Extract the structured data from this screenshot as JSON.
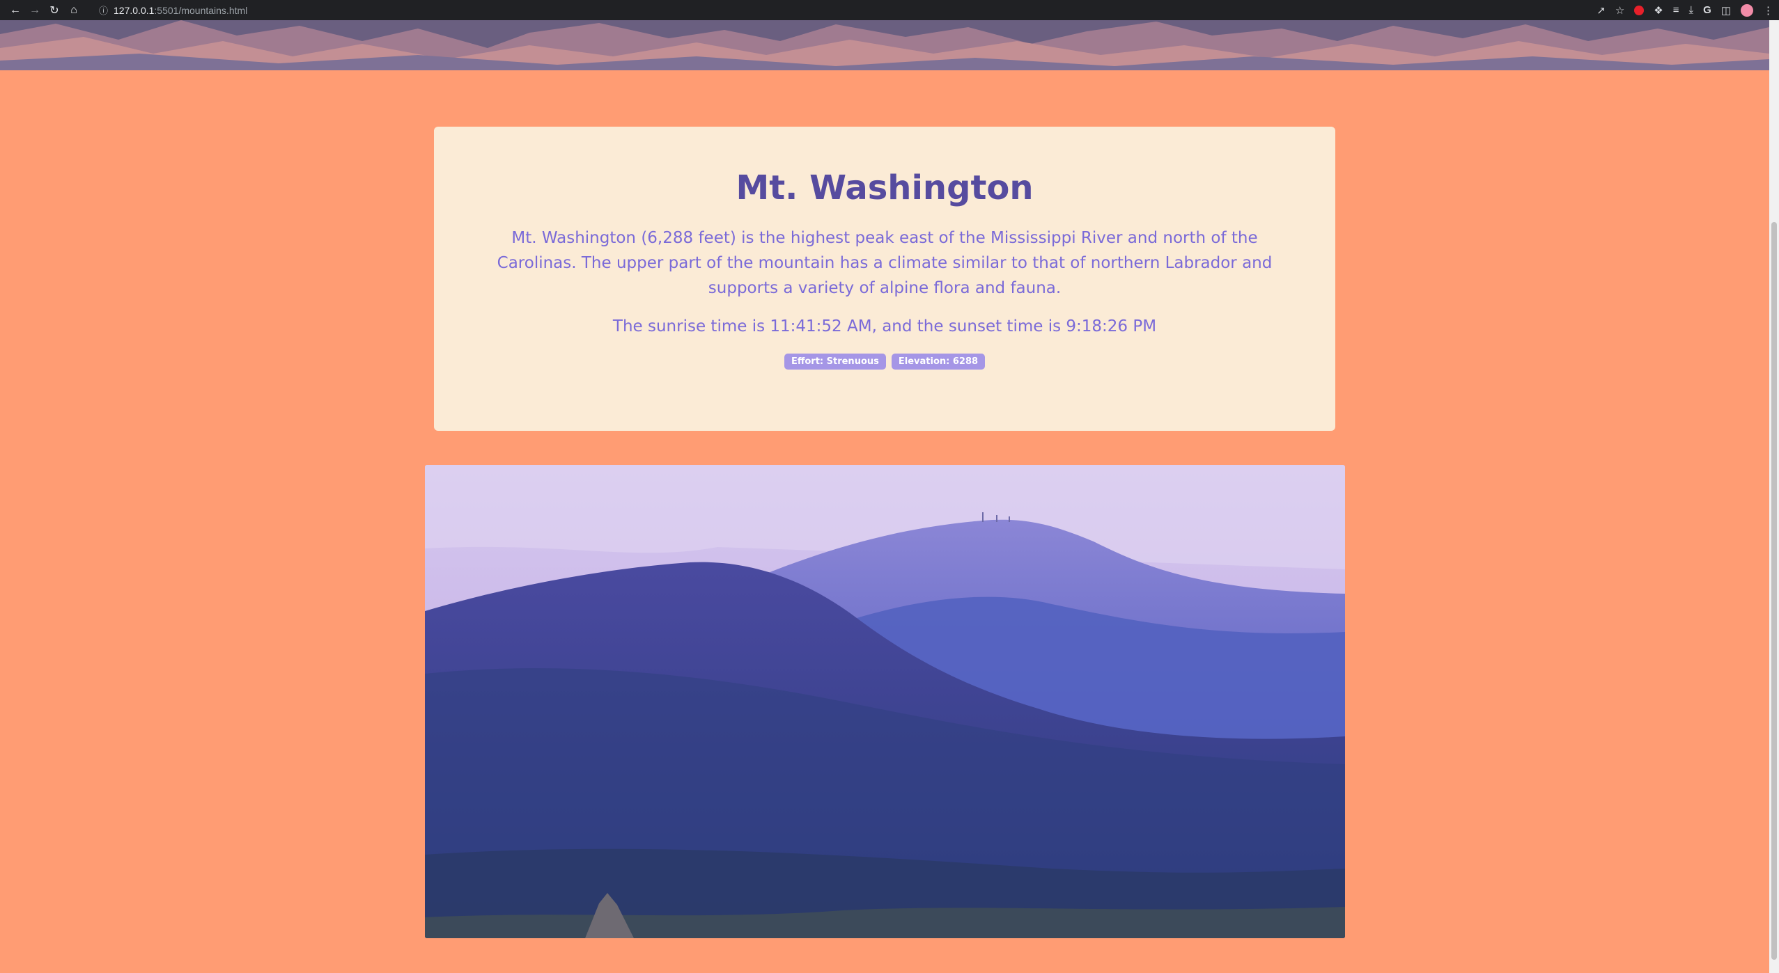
{
  "browser": {
    "url_host": "127.0.0.1",
    "url_path": ":5501/mountains.html",
    "icons": [
      "back-icon",
      "forward-icon",
      "reload-icon",
      "home-icon",
      "info-icon",
      "share-icon",
      "star-icon",
      "extension-record-icon",
      "puzzle-icon",
      "reading-list-icon",
      "download-icon",
      "google-icon",
      "sidebar-icon",
      "avatar",
      "menu-icon"
    ]
  },
  "mountain": {
    "name": "Mt. Washington",
    "description": "Mt. Washington (6,288 feet) is the highest peak east of the Mississippi River and north of the Carolinas. The upper part of the mountain has a climate similar to that of northern Labrador and supports a variety of alpine flora and fauna.",
    "times": "The sunrise time is 11:41:52 AM, and the sunset time is 9:18:26 PM",
    "badges": {
      "effort": "Effort: Strenuous",
      "elevation": "Elevation: 6288"
    }
  },
  "colors": {
    "page_background": "#ff9c73",
    "card_background": "#fbebd6",
    "title": "#564b9f",
    "text": "#7a6ad8",
    "badge": "#a596e6"
  }
}
